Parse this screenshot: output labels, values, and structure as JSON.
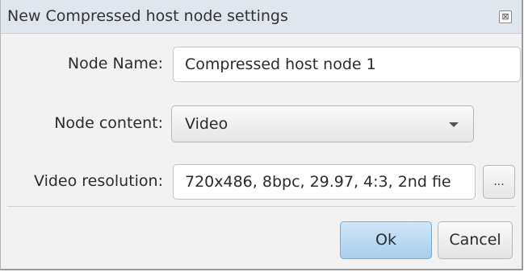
{
  "window": {
    "title": "New Compressed host node settings",
    "close_glyph": "⊠"
  },
  "form": {
    "node_name_label": "Node Name:",
    "node_name_value": "Compressed host node 1",
    "node_content_label": "Node content:",
    "node_content_value": "Video",
    "video_resolution_label": "Video resolution:",
    "video_resolution_value": "720x486, 8bpc, 29.97, 4:3, 2nd fie",
    "browse_label": "..."
  },
  "buttons": {
    "ok": "Ok",
    "cancel": "Cancel"
  },
  "colors": {
    "titlebar": "#dfe6ee",
    "ok_button": "#bcdcf2"
  }
}
